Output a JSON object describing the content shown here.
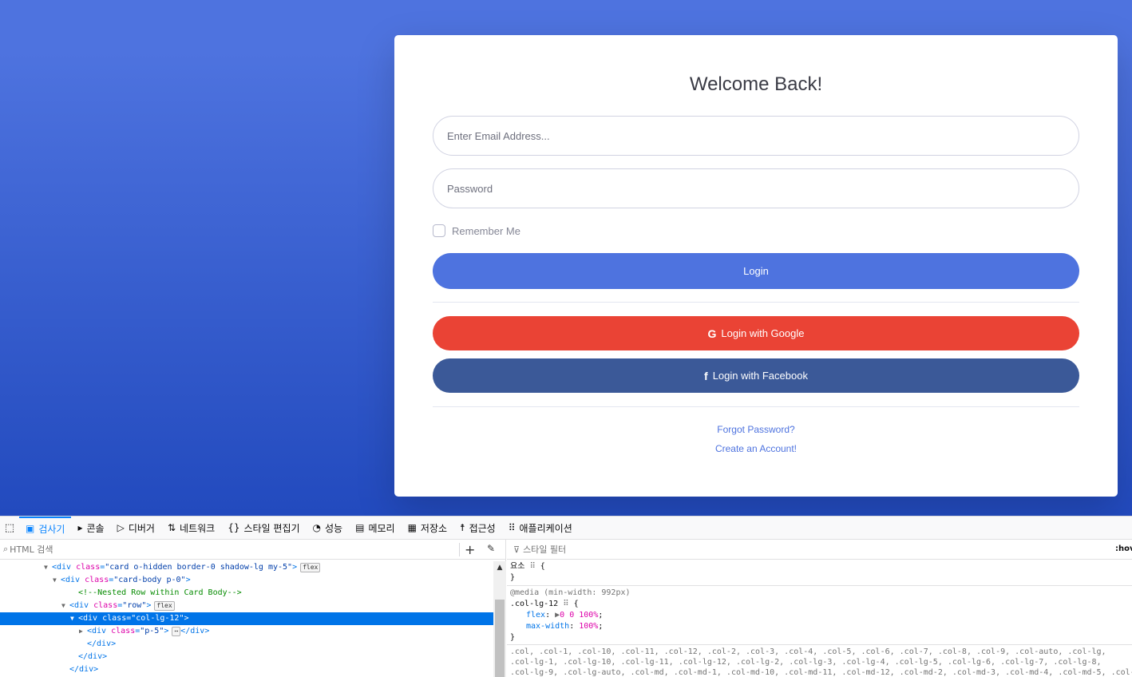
{
  "login": {
    "title": "Welcome Back!",
    "email_placeholder": "Enter Email Address...",
    "password_placeholder": "Password",
    "remember_label": "Remember Me",
    "login_button": "Login",
    "google_button": "Login with Google",
    "facebook_button": "Login with Facebook",
    "google_icon": "G",
    "facebook_icon": "f",
    "forgot_link": "Forgot Password?",
    "create_link": "Create an Account!"
  },
  "colors": {
    "primary": "#4e73df",
    "google": "#ea4335",
    "facebook": "#3b5998",
    "devtools_accent": "#0a84ff"
  },
  "devtools": {
    "tabs": [
      {
        "label": "검사기",
        "icon": "inspector-icon",
        "glyph": "▣"
      },
      {
        "label": "콘솔",
        "icon": "console-icon",
        "glyph": "▸"
      },
      {
        "label": "디버거",
        "icon": "debugger-icon",
        "glyph": "▷"
      },
      {
        "label": "네트워크",
        "icon": "network-icon",
        "glyph": "⇅"
      },
      {
        "label": "스타일 편집기",
        "icon": "style-editor-icon",
        "glyph": "{}"
      },
      {
        "label": "성능",
        "icon": "performance-icon",
        "glyph": "◔"
      },
      {
        "label": "메모리",
        "icon": "memory-icon",
        "glyph": "▤"
      },
      {
        "label": "저장소",
        "icon": "storage-icon",
        "glyph": "▦"
      },
      {
        "label": "접근성",
        "icon": "accessibility-icon",
        "glyph": "☨"
      },
      {
        "label": "애플리케이션",
        "icon": "application-icon",
        "glyph": "⠿"
      }
    ],
    "html_search_placeholder": "HTML 검색",
    "style_filter_placeholder": "스타일 필터",
    "hov_label": ":hov",
    "tree": [
      {
        "indent": 5,
        "arrow": "▼",
        "parts": [
          [
            "tag",
            "<div "
          ],
          [
            "attr",
            "class"
          ],
          [
            "tag",
            "="
          ],
          [
            "val",
            "\"card o-hidden border-0 shadow-lg my-5\""
          ],
          [
            "tag",
            ">"
          ]
        ],
        "badge": "flex"
      },
      {
        "indent": 6,
        "arrow": "▼",
        "parts": [
          [
            "tag",
            "<div "
          ],
          [
            "attr",
            "class"
          ],
          [
            "tag",
            "="
          ],
          [
            "val",
            "\"card-body p-0\""
          ],
          [
            "tag",
            ">"
          ]
        ],
        "badge": ""
      },
      {
        "indent": 8,
        "arrow": "",
        "parts": [
          [
            "cmt",
            "<!--Nested Row within Card Body-->"
          ]
        ],
        "badge": ""
      },
      {
        "indent": 7,
        "arrow": "▼",
        "parts": [
          [
            "tag",
            "<div "
          ],
          [
            "attr",
            "class"
          ],
          [
            "tag",
            "="
          ],
          [
            "val",
            "\"row\""
          ],
          [
            "tag",
            ">"
          ]
        ],
        "badge": "flex"
      },
      {
        "indent": 8,
        "arrow": "▼",
        "parts": [
          [
            "tag",
            "<div "
          ],
          [
            "attr",
            "class"
          ],
          [
            "tag",
            "="
          ],
          [
            "val",
            "\"col-lg-12\""
          ],
          [
            "tag",
            ">"
          ]
        ],
        "badge": "",
        "selected": true
      },
      {
        "indent": 9,
        "arrow": "▶",
        "parts": [
          [
            "tag",
            "<div "
          ],
          [
            "attr",
            "class"
          ],
          [
            "tag",
            "="
          ],
          [
            "val",
            "\"p-5\""
          ],
          [
            "tag",
            ">"
          ],
          [
            "badge",
            "⋯"
          ],
          [
            "tag",
            "</div>"
          ]
        ],
        "badge": ""
      },
      {
        "indent": 9,
        "arrow": "",
        "parts": [
          [
            "tag",
            "</div>"
          ]
        ],
        "badge": ""
      },
      {
        "indent": 8,
        "arrow": "",
        "parts": [
          [
            "tag",
            "</div>"
          ]
        ],
        "badge": ""
      },
      {
        "indent": 7,
        "arrow": "",
        "parts": [
          [
            "tag",
            "</div>"
          ]
        ],
        "badge": ""
      }
    ],
    "rules": {
      "element_selector": "요소",
      "element_brace": "{",
      "close_brace": "}",
      "media": "@media (min-width: 992px)",
      "selector": ".col-lg-12",
      "props": [
        {
          "name": "flex",
          "value": "0 0 100%"
        },
        {
          "name": "max-width",
          "value": "100%"
        }
      ],
      "multi_selector_line1": ".col, .col-1, .col-10, .col-11, .col-12, .col-2, .col-3, .col-4, .col-5, .col-6, .col-7, .col-8, .col-9, .col-auto, .col-lg,",
      "multi_selector_line2": ".col-lg-1, .col-lg-10, .col-lg-11, .col-lg-12, .col-lg-2, .col-lg-3, .col-lg-4, .col-lg-5, .col-lg-6, .col-lg-7, .col-lg-8,",
      "multi_selector_line3": ".col-lg-9, .col-lg-auto, .col-md, .col-md-1, .col-md-10, .col-md-11, .col-md-12, .col-md-2, .col-md-3, .col-md-4, .col-md-5, .col-"
    }
  }
}
